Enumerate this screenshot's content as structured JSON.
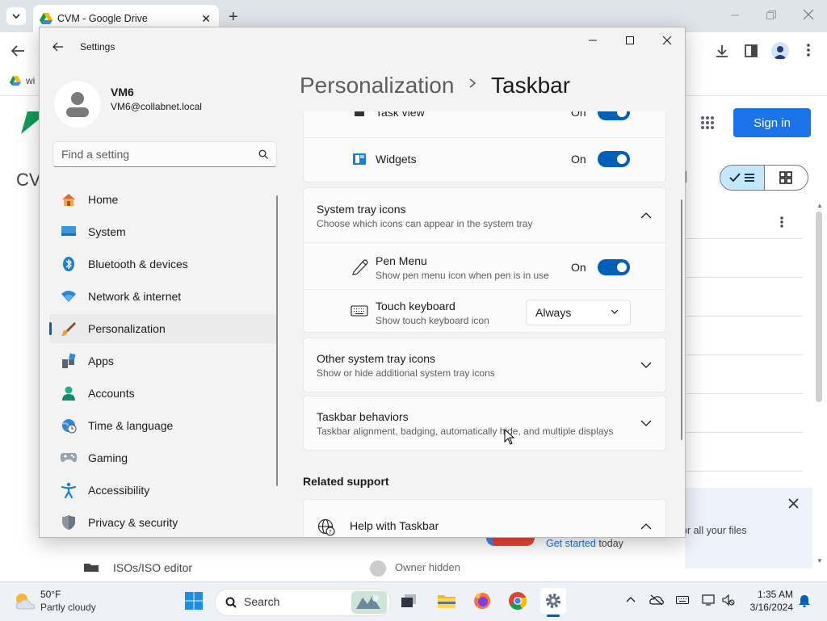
{
  "browser": {
    "tab_title": "CVM - Google Drive",
    "bookmark_partial": "wi",
    "drive_heading_partial": "CV",
    "sign_in": "Sign in",
    "promo_text": "or all your files",
    "promo_get_started": "Get started",
    "promo_today": " today",
    "bg_row_partial": "ISOs/ISO editor",
    "bg_owner_partial": "Owner hidden"
  },
  "settings": {
    "app_title": "Settings",
    "user_name": "VM6",
    "user_email": "VM6@collabnet.local",
    "search_placeholder": "Find a setting",
    "breadcrumb_parent": "Personalization",
    "breadcrumb_current": "Taskbar",
    "nav": [
      {
        "label": "Home",
        "icon": "home-icon"
      },
      {
        "label": "System",
        "icon": "system-icon"
      },
      {
        "label": "Bluetooth & devices",
        "icon": "bluetooth-icon"
      },
      {
        "label": "Network & internet",
        "icon": "wifi-icon"
      },
      {
        "label": "Personalization",
        "icon": "brush-icon",
        "active": true
      },
      {
        "label": "Apps",
        "icon": "apps-icon"
      },
      {
        "label": "Accounts",
        "icon": "person-icon"
      },
      {
        "label": "Time & language",
        "icon": "globe-clock-icon"
      },
      {
        "label": "Gaming",
        "icon": "gamepad-icon"
      },
      {
        "label": "Accessibility",
        "icon": "accessibility-icon"
      },
      {
        "label": "Privacy & security",
        "icon": "shield-icon"
      }
    ],
    "taskbar_items": {
      "task_view": {
        "label": "Task view",
        "state": "On"
      },
      "widgets": {
        "label": "Widgets",
        "state": "On"
      }
    },
    "system_tray": {
      "title": "System tray icons",
      "subtitle": "Choose which icons can appear in the system tray",
      "pen_menu": {
        "label": "Pen Menu",
        "desc": "Show pen menu icon when pen is in use",
        "state": "On"
      },
      "touch_keyboard": {
        "label": "Touch keyboard",
        "desc": "Show touch keyboard icon",
        "value": "Always"
      }
    },
    "other_tray": {
      "title": "Other system tray icons",
      "subtitle": "Show or hide additional system tray icons"
    },
    "behaviors": {
      "title": "Taskbar behaviors",
      "subtitle": "Taskbar alignment, badging, automatically hide, and multiple displays"
    },
    "related_support": "Related support",
    "help": "Help with Taskbar"
  },
  "taskbar": {
    "weather_temp": "50°F",
    "weather_desc": "Partly cloudy",
    "search_label": "Search",
    "time": "1:35 AM",
    "date": "3/16/2024"
  },
  "colors": {
    "accent": "#005fb8",
    "chrome_blue": "#1a73e8"
  }
}
